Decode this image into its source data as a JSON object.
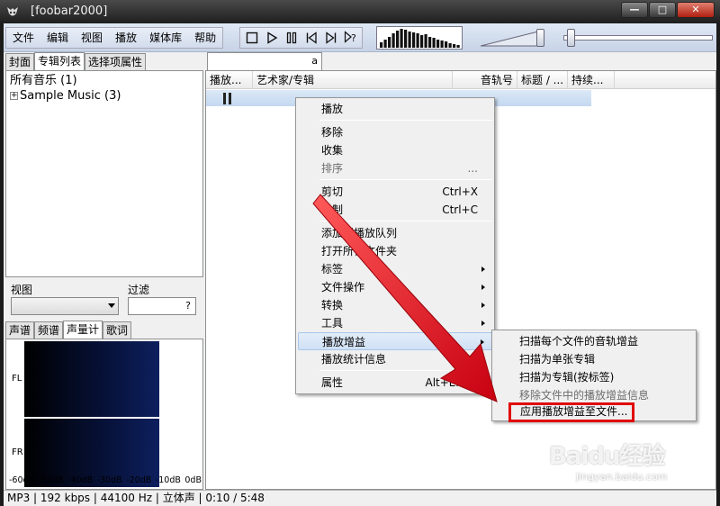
{
  "window": {
    "title": "[foobar2000]"
  },
  "menubar": [
    "文件",
    "编辑",
    "视图",
    "播放",
    "媒体库",
    "帮助"
  ],
  "left": {
    "tabs": [
      "封面",
      "专辑列表",
      "选择项属性"
    ],
    "active_tab": "专辑列表",
    "tree": {
      "root": "所有音乐 (1)",
      "child": "Sample Music (3)"
    },
    "view_label": "视图",
    "filter_label": "过滤",
    "filter_hint": "?",
    "vis_tabs": [
      "声谱",
      "频谱",
      "声量计",
      "歌词"
    ],
    "active_vis_tab": "声量计",
    "channels": [
      "FL",
      "FR"
    ],
    "db_scale": [
      "-60dB",
      "-50dB",
      "-40dB",
      "-30dB",
      "-20dB",
      "-10dB",
      "0dB"
    ]
  },
  "playlist": {
    "tab_label": "a",
    "columns": [
      "播放...",
      "艺术家/专辑",
      "音轨号",
      "标题 / ...",
      "持续..."
    ]
  },
  "context_menu": {
    "items": [
      {
        "label": "播放",
        "shortcut": "",
        "submenu": false,
        "disabled": false
      },
      {
        "label": "移除",
        "shortcut": "",
        "submenu": false,
        "disabled": false
      },
      {
        "label": "收集",
        "shortcut": "",
        "submenu": false,
        "disabled": false
      },
      {
        "label": "排序",
        "shortcut": "...",
        "submenu": false,
        "disabled": true
      },
      {
        "label": "剪切",
        "shortcut": "Ctrl+X",
        "submenu": false,
        "disabled": false
      },
      {
        "label": "复制",
        "shortcut": "Ctrl+C",
        "submenu": false,
        "disabled": false
      },
      {
        "label": "添加到播放队列",
        "shortcut": "",
        "submenu": false,
        "disabled": false
      },
      {
        "label": "打开所在文件夹",
        "shortcut": "",
        "submenu": false,
        "disabled": false
      },
      {
        "label": "标签",
        "shortcut": "",
        "submenu": true,
        "disabled": false
      },
      {
        "label": "文件操作",
        "shortcut": "",
        "submenu": true,
        "disabled": false
      },
      {
        "label": "转换",
        "shortcut": "",
        "submenu": true,
        "disabled": false
      },
      {
        "label": "工具",
        "shortcut": "",
        "submenu": true,
        "disabled": false
      },
      {
        "label": "播放增益",
        "shortcut": "",
        "submenu": true,
        "disabled": false
      },
      {
        "label": "播放统计信息",
        "shortcut": "",
        "submenu": false,
        "disabled": false
      },
      {
        "label": "属性",
        "shortcut": "Alt+Enter",
        "submenu": false,
        "disabled": false
      }
    ]
  },
  "replaygain_submenu": {
    "items": [
      {
        "label": "扫描每个文件的音轨增益",
        "disabled": false
      },
      {
        "label": "扫描为单张专辑",
        "disabled": false
      },
      {
        "label": "扫描为专辑(按标签)",
        "disabled": false
      },
      {
        "label": "移除文件中的播放增益信息",
        "disabled": true
      },
      {
        "label": "应用播放增益至文件...",
        "disabled": false
      }
    ]
  },
  "statusbar": {
    "text": "MP3 | 192 kbps | 44100 Hz | 立体声 | 0:10 / 5:48"
  },
  "watermark": {
    "brand": "Baidu经验",
    "url": "jingyan.baidu.com"
  },
  "colors": {
    "highlight_border": "#e00000",
    "arrow": "#e8141a",
    "meter_blue": "#0d1f5e"
  }
}
